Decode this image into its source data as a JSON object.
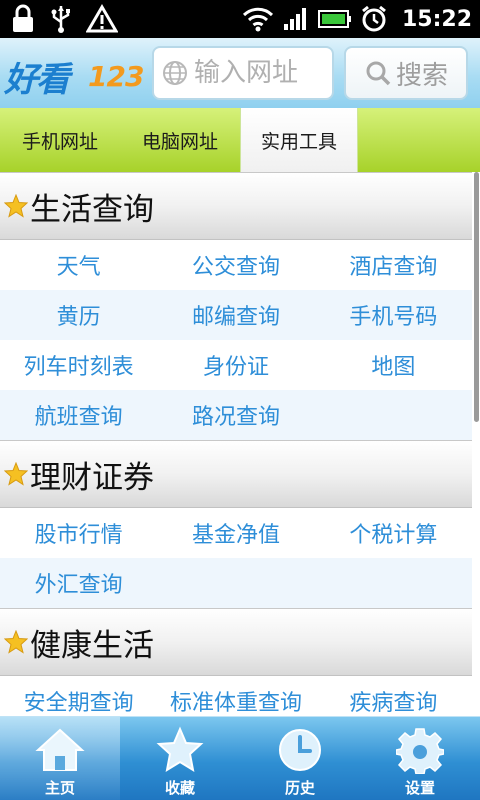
{
  "status_bar": {
    "time": "15:22"
  },
  "header": {
    "logo_text": "好看",
    "logo_number": "123",
    "url_placeholder": "输入网址",
    "search_label": "搜索"
  },
  "tabs": [
    {
      "label": "手机网址"
    },
    {
      "label": "电脑网址"
    },
    {
      "label": "实用工具",
      "active": true
    }
  ],
  "sections": [
    {
      "title": "生活查询",
      "rows": [
        [
          "天气",
          "公交查询",
          "酒店查询"
        ],
        [
          "黄历",
          "邮编查询",
          "手机号码"
        ],
        [
          "列车时刻表",
          "身份证",
          "地图"
        ],
        [
          "航班查询",
          "路况查询",
          ""
        ]
      ]
    },
    {
      "title": "理财证券",
      "rows": [
        [
          "股市行情",
          "基金净值",
          "个税计算"
        ],
        [
          "外汇查询",
          "",
          ""
        ]
      ]
    },
    {
      "title": "健康生活",
      "rows": [
        [
          "安全期查询",
          "标准体重查询",
          "疾病查询"
        ]
      ]
    }
  ],
  "bottom_nav": [
    {
      "label": "主页",
      "icon": "home-icon",
      "active": true
    },
    {
      "label": "收藏",
      "icon": "star-icon"
    },
    {
      "label": "历史",
      "icon": "clock-icon"
    },
    {
      "label": "设置",
      "icon": "gear-icon"
    }
  ],
  "colors": {
    "link_blue": "#2e8ed8",
    "tab_green": "#a7d22a",
    "nav_blue": "#2f8fd3"
  }
}
